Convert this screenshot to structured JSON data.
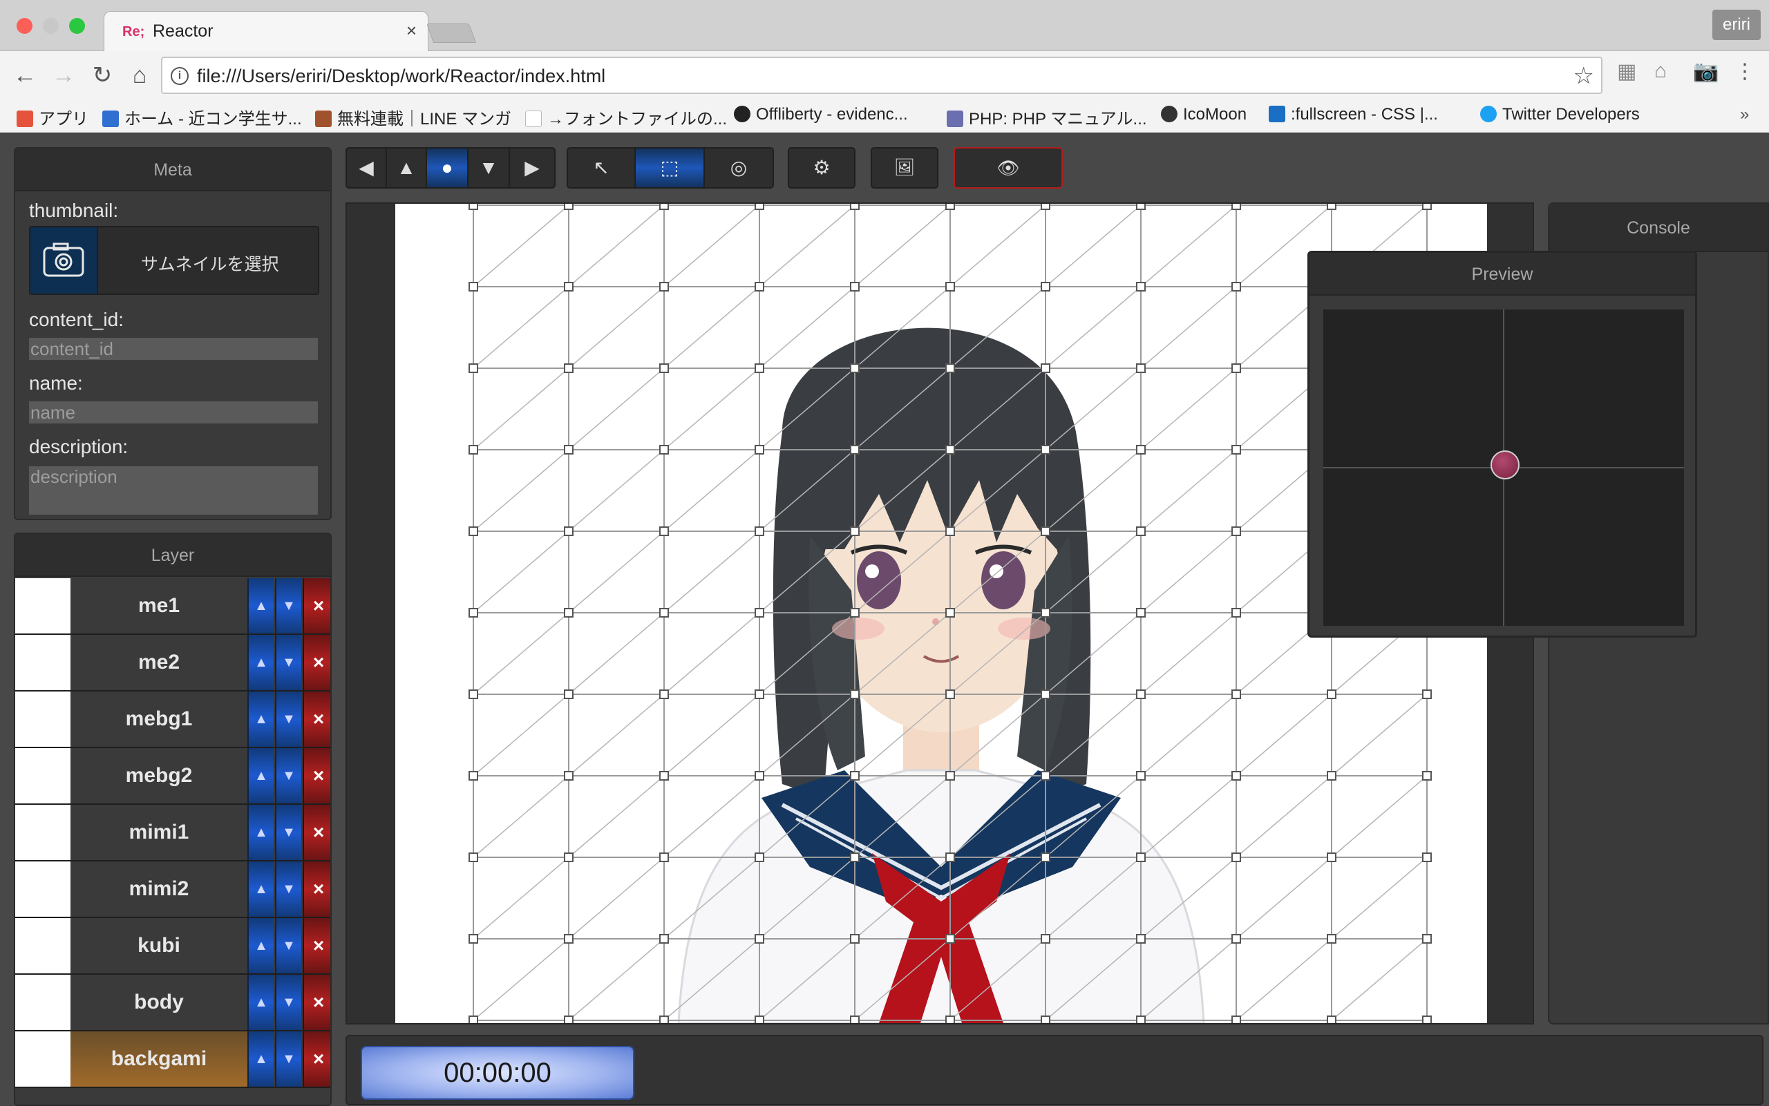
{
  "browser": {
    "tab_favicon": "Re;",
    "tab_title": "Reactor",
    "tab_close": "×",
    "user": "eriri",
    "url": "file:///Users/eriri/Desktop/work/Reactor/index.html",
    "bookmarks": [
      {
        "label": "アプリ",
        "icon": "apps-grid-icon",
        "color": "#e5533d"
      },
      {
        "label": "ホーム - 近コン学生サ...",
        "icon": "s-logo-icon",
        "color": "#2f6fd0"
      },
      {
        "label": "無料連載｜LINE マンガ",
        "icon": "manga-icon",
        "color": "#a0522d"
      },
      {
        "label": "→フォントファイルの...",
        "icon": "page-icon",
        "color": "#bbbbbb"
      },
      {
        "label": "Offliberty - evidenc...",
        "icon": "power-icon",
        "color": "#222222"
      },
      {
        "label": "PHP: PHP マニュアル...",
        "icon": "php-icon",
        "color": "#6a6fb0"
      },
      {
        "label": "IcoMoon",
        "icon": "icomoon-icon",
        "color": "#333333"
      },
      {
        "label": ":fullscreen - CSS |...",
        "icon": "mdn-icon",
        "color": "#1a6fc4"
      },
      {
        "label": "Twitter Developers",
        "icon": "twitter-icon",
        "color": "#1da1f2"
      }
    ],
    "bookmarks_more": "»"
  },
  "meta": {
    "title": "Meta",
    "thumbnail_label": "thumbnail:",
    "thumbnail_button": "サムネイルを選択",
    "content_id_label": "content_id:",
    "content_id_placeholder": "content_id",
    "name_label": "name:",
    "name_placeholder": "name",
    "description_label": "description:",
    "description_placeholder": "description"
  },
  "layer": {
    "title": "Layer",
    "items": [
      {
        "name": "me1",
        "selected": false
      },
      {
        "name": "me2",
        "selected": false
      },
      {
        "name": "mebg1",
        "selected": false
      },
      {
        "name": "mebg2",
        "selected": false
      },
      {
        "name": "mimi1",
        "selected": false
      },
      {
        "name": "mimi2",
        "selected": false
      },
      {
        "name": "kubi",
        "selected": false
      },
      {
        "name": "body",
        "selected": false
      },
      {
        "name": "backgami",
        "selected": true
      }
    ],
    "delete_glyph": "×"
  },
  "toolbar": {
    "nav": [
      "◀",
      "▲",
      "●",
      "▼",
      "▶"
    ],
    "tools": [
      "↖",
      "⬚",
      "◎"
    ],
    "settings": "⚙",
    "image": "🖼",
    "eye": "👁"
  },
  "console": {
    "title": "Console"
  },
  "preview": {
    "title": "Preview",
    "handle_color": "#8a2a4a"
  },
  "timeline": {
    "timecode": "00:00:00"
  },
  "colors": {
    "accent_blue": "#1e57b8",
    "danger_red": "#b22020",
    "selected_orange": "#a06a2a"
  }
}
